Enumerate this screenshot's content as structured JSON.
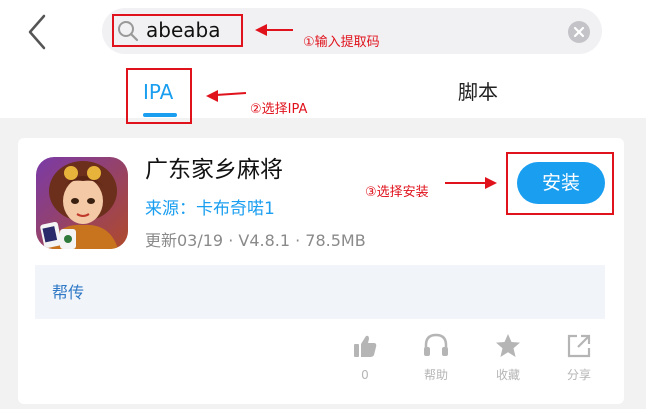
{
  "search": {
    "query": "abeaba"
  },
  "tabs": [
    {
      "label": "IPA",
      "active": true
    },
    {
      "label": "脚本",
      "active": false
    }
  ],
  "app": {
    "name": "广东家乡麻将",
    "source": "来源：卡布奇喏1",
    "meta": "更新03/19 · V4.8.1 · 78.5MB",
    "install_label": "安装",
    "help_text": "帮传"
  },
  "actions": [
    {
      "label": "0",
      "icon": "thumbs-up-icon"
    },
    {
      "label": "帮助",
      "icon": "headset-icon"
    },
    {
      "label": "收藏",
      "icon": "star-icon"
    },
    {
      "label": "分享",
      "icon": "share-icon"
    }
  ],
  "annotations": {
    "step1": "①输入提取码",
    "step2": "②选择IPA",
    "step3": "③选择安装"
  },
  "colors": {
    "accent": "#1a9ef0",
    "annotation": "#e0121c",
    "background": "#f2f2f2"
  }
}
